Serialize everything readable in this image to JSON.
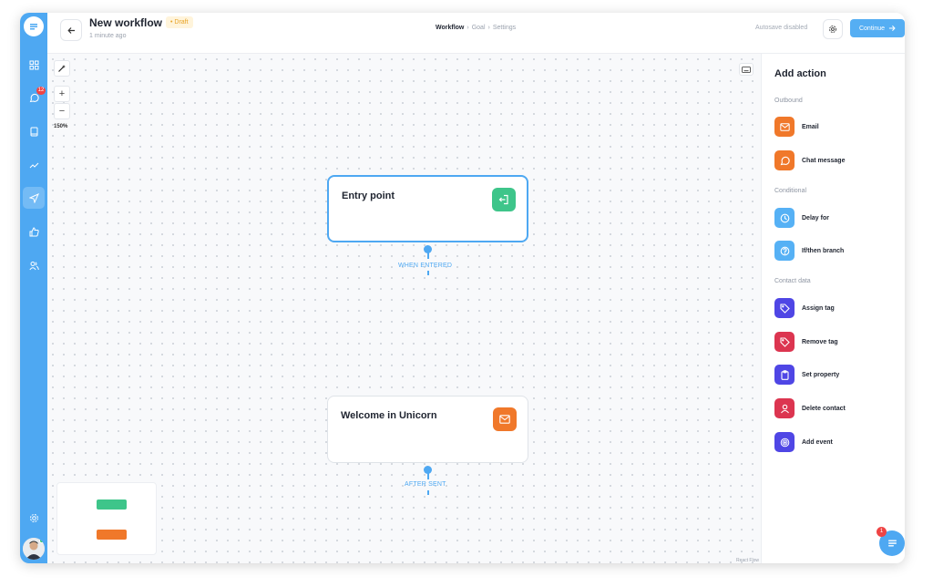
{
  "header": {
    "title": "New workflow",
    "draft_badge": "• Draft",
    "subtitle": "1 minute ago",
    "breadcrumb": [
      "Workflow",
      "Goal",
      "Settings"
    ],
    "autosave": "Autosave disabled",
    "continue_label": "Continue"
  },
  "sidebar": {
    "items": [
      {
        "icon": "dashboard-icon"
      },
      {
        "icon": "chat-icon",
        "badge": "12"
      },
      {
        "icon": "book-icon"
      },
      {
        "icon": "analytics-icon"
      },
      {
        "icon": "send-icon",
        "active": true
      },
      {
        "icon": "thumbs-up-icon"
      },
      {
        "icon": "users-icon"
      },
      {
        "icon": "settings-icon"
      }
    ]
  },
  "canvas": {
    "zoom": "150%",
    "nodes": [
      {
        "title": "Entry point",
        "icon": "entry-icon",
        "color": "#3ec58a",
        "connector_label": "WHEN ENTERED"
      },
      {
        "title": "Welcome in Unicorn",
        "icon": "email-icon",
        "color": "#f0782a",
        "connector_label": "AFTER SENT"
      }
    ],
    "credit": "React Flow"
  },
  "panel": {
    "title": "Add action",
    "sections": [
      {
        "name": "Outbound",
        "actions": [
          {
            "label": "Email",
            "icon": "email-icon",
            "color": "#f0782a"
          },
          {
            "label": "Chat message",
            "icon": "chat-bubble-icon",
            "color": "#f0782a"
          }
        ]
      },
      {
        "name": "Conditional",
        "actions": [
          {
            "label": "Delay for",
            "icon": "clock-icon",
            "color": "#56b1f5"
          },
          {
            "label": "If/then branch",
            "icon": "question-icon",
            "color": "#56b1f5"
          }
        ]
      },
      {
        "name": "Contact data",
        "actions": [
          {
            "label": "Assign tag",
            "icon": "tag-icon",
            "color": "#4f46e5"
          },
          {
            "label": "Remove tag",
            "icon": "tag-icon",
            "color": "#dc3550"
          },
          {
            "label": "Set property",
            "icon": "clipboard-icon",
            "color": "#4f46e5"
          },
          {
            "label": "Delete contact",
            "icon": "user-icon",
            "color": "#dc3550"
          },
          {
            "label": "Add event",
            "icon": "target-icon",
            "color": "#4f46e5"
          }
        ]
      }
    ]
  },
  "chat_widget": {
    "badge": "1"
  }
}
